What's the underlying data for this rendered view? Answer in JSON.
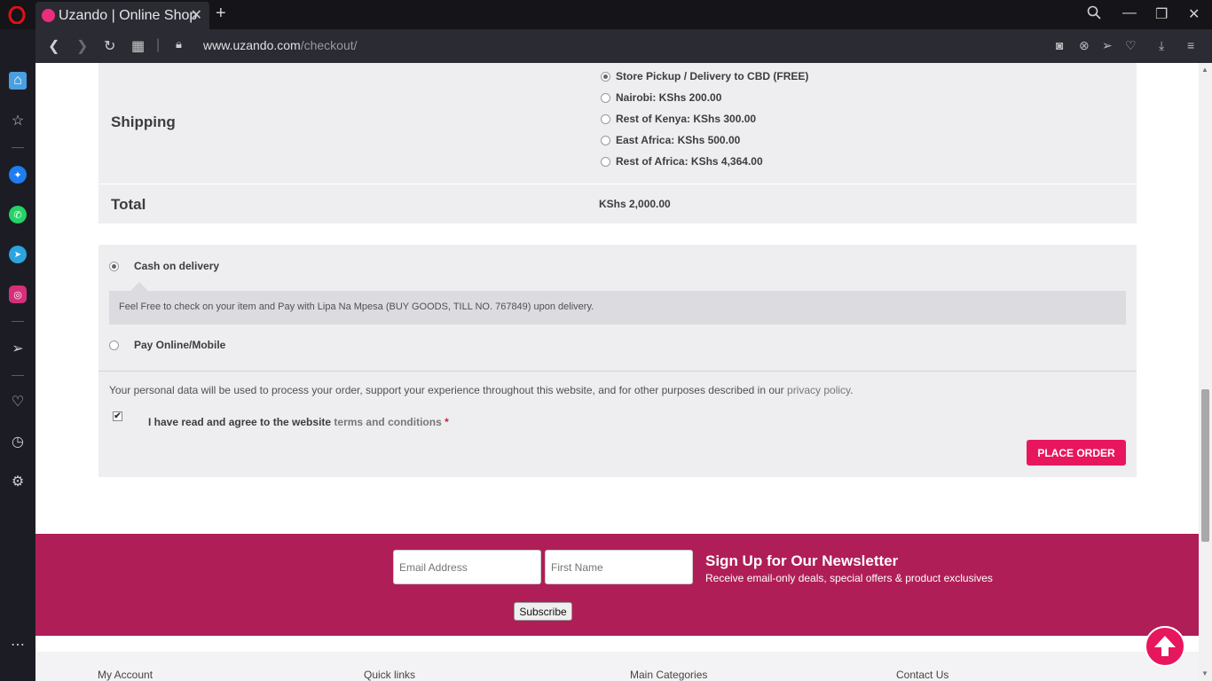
{
  "browser": {
    "tab_title": "Uzando | Online Shop",
    "url_host": "www.uzando.com",
    "url_path": "/checkout/"
  },
  "sidebar": {
    "icons": [
      "home-icon",
      "star-icon",
      "messenger-icon",
      "whatsapp-icon",
      "telegram-icon",
      "instagram-icon",
      "send-icon",
      "heart-icon",
      "history-icon",
      "settings-icon",
      "more-icon"
    ]
  },
  "order": {
    "shipping_label": "Shipping",
    "shipping_options": [
      {
        "label": "Store Pickup / Delivery to CBD (FREE)",
        "selected": true
      },
      {
        "label": "Nairobi: KShs 200.00",
        "selected": false
      },
      {
        "label": "Rest of Kenya: KShs 300.00",
        "selected": false
      },
      {
        "label": "East Africa: KShs 500.00",
        "selected": false
      },
      {
        "label": "Rest of Africa: KShs 4,364.00",
        "selected": false
      }
    ],
    "total_label": "Total",
    "total_value": "KShs 2,000.00"
  },
  "payment": {
    "methods": [
      {
        "label": "Cash on delivery",
        "selected": true
      },
      {
        "label": "Pay Online/Mobile",
        "selected": false
      }
    ],
    "cod_description": "Feel Free to check on your item and Pay with Lipa Na Mpesa (BUY GOODS, TILL NO. 767849) upon delivery.",
    "privacy_text": "Your personal data will be used to process your order, support your experience throughout this website, and for other purposes described in our ",
    "privacy_link": "privacy policy",
    "privacy_end": ".",
    "terms_text": "I have read and agree to the website ",
    "terms_link": "terms and conditions",
    "terms_required": "*",
    "terms_checked": true,
    "place_order": "PLACE ORDER"
  },
  "newsletter": {
    "email_placeholder": "Email Address",
    "firstname_placeholder": "First Name",
    "title": "Sign Up for Our Newsletter",
    "subtitle": "Receive email-only deals, special offers & product exclusives",
    "subscribe": "Subscribe"
  },
  "footer": {
    "headings": [
      "My Account",
      "Quick links",
      "Main Categories",
      "Contact Us"
    ]
  },
  "colors": {
    "accent": "#e8175d",
    "newsletter_bg": "#b01e57"
  }
}
